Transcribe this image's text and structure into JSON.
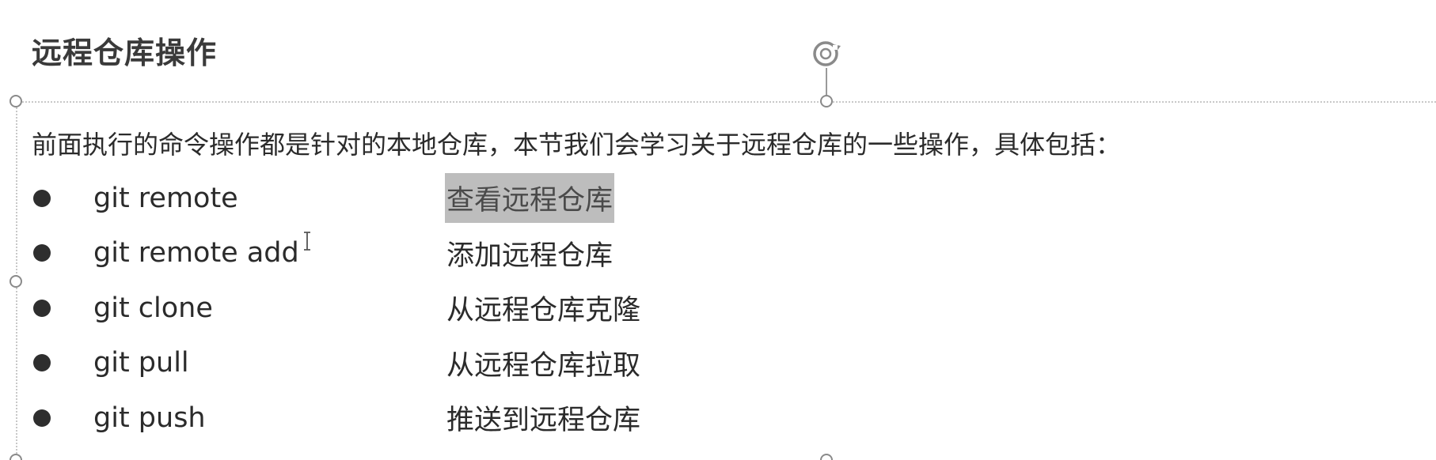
{
  "slide": {
    "title": "远程仓库操作",
    "intro": "前面执行的命令操作都是针对的本地仓库，本节我们会学习关于远程仓库的一些操作，具体包括：",
    "items": [
      {
        "command": "git remote",
        "description": "查看远程仓库",
        "highlighted": true
      },
      {
        "command": "git remote add",
        "description": "添加远程仓库",
        "highlighted": false
      },
      {
        "command": "git clone",
        "description": "从远程仓库克隆",
        "highlighted": false
      },
      {
        "command": "git pull",
        "description": "从远程仓库拉取",
        "highlighted": false
      },
      {
        "command": "git push",
        "description": "推送到远程仓库",
        "highlighted": false
      }
    ]
  },
  "icons": {
    "rotate_handle": "rotate-icon",
    "text_cursor": "i-beam-cursor-icon",
    "bullet": "bullet-icon"
  },
  "colors": {
    "text": "#2b2b2b",
    "highlight": "#bdbdbd",
    "frame": "#c8c8c8"
  }
}
